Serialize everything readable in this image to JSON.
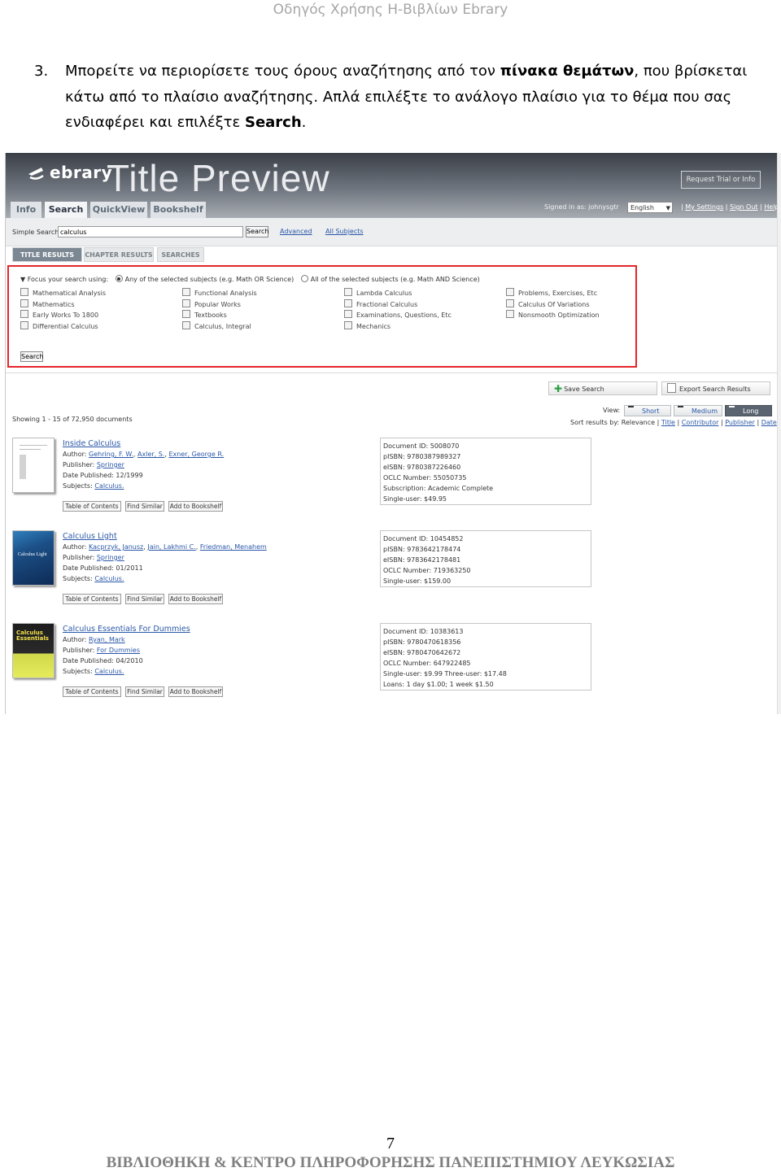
{
  "doc": {
    "header": "Οδηγός Χρήσης Η-Βιβλίων Ebrary",
    "step_number": "3.",
    "step_text_1": "Μπορείτε να περιορίσετε τους όρους αναζήτησης από τον ",
    "step_bold_1": "πίνακα θεμάτων",
    "step_text_2": ", που βρίσκεται κάτω από το πλαίσιο αναζήτησης. Απλά επιλέξτε το ανάλογο πλαίσιο για το θέμα που σας ενδιαφέρει και επιλέξτε ",
    "step_bold_2": "Search",
    "step_text_3": ".",
    "page_number": "7",
    "footer": "ΒΙΒΛΙΟΘΗΚΗ & ΚΕΝΤΡΟ ΠΛΗΡΟΦΟΡΗΣΗΣ ΠΑΝΕΠΙΣΤΗΜΙΟΥ ΛΕΥΚΩΣΙΑΣ"
  },
  "app": {
    "logo": "ebrary",
    "title": "Title Preview",
    "request_button": "Request Trial or Info",
    "tabs": [
      "Info",
      "Search",
      "QuickView",
      "Bookshelf"
    ],
    "active_tab": "Search",
    "signed_in": "Signed in as: johnysgtr",
    "language": "English",
    "top_links": [
      "My Settings",
      "Sign Out",
      "Help"
    ],
    "simple_search_label": "Simple Search:",
    "search_value": "calculus",
    "search_button": "Search",
    "advanced_link": "Advanced",
    "all_subjects_link": "All Subjects",
    "result_tabs": [
      "TITLE RESULTS",
      "CHAPTER RESULTS",
      "SEARCHES"
    ],
    "focus_label": "Focus your search using:",
    "focus_any": "Any of the selected subjects (e.g. Math OR Science)",
    "focus_all": "All of the selected subjects (e.g. Math AND Science)",
    "subjects": [
      [
        "Mathematical Analysis",
        "Mathematics",
        "Early Works To 1800",
        "Differential Calculus"
      ],
      [
        "Functional Analysis",
        "Popular Works",
        "Textbooks",
        "Calculus, Integral"
      ],
      [
        "Lambda Calculus",
        "Fractional Calculus",
        "Examinations, Questions, Etc",
        "Mechanics"
      ],
      [
        "Problems, Exercises, Etc",
        "Calculus Of Variations",
        "Nonsmooth Optimization"
      ]
    ],
    "panel_search_button": "Search",
    "save_search": "Save Search",
    "export_results": "Export Search Results",
    "view_label": "View:",
    "view_options": [
      "Short",
      "Medium",
      "Long"
    ],
    "active_view": "Long",
    "sort_label": "Sort results by: Relevance",
    "sort_links": [
      "Title",
      "Contributor",
      "Publisher",
      "Date"
    ],
    "showing": "Showing 1 - 15 of 72,950 documents",
    "result_buttons": [
      "Table of Contents",
      "Find Similar",
      "Add to Bookshelf"
    ],
    "results": [
      {
        "title": "Inside Calculus",
        "author_label": "Author:",
        "authors": [
          "Gehring, F. W.",
          "Axler, S.",
          "Exner, George R."
        ],
        "publisher_label": "Publisher:",
        "publisher": "Springer",
        "date": "Date Published: 12/1999",
        "subjects_label": "Subjects:",
        "subjects": "Calculus.",
        "details": [
          "Document ID: 5008070",
          "pISBN: 9780387989327",
          "eISBN: 9780387226460",
          "OCLC Number: 55050735",
          "Subscription: Academic Complete",
          "Single-user: $49.95"
        ]
      },
      {
        "title": "Calculus Light",
        "author_label": "Author:",
        "authors": [
          "Kacprzyk, Janusz",
          "Jain, Lakhmi C.",
          "Friedman, Menahem"
        ],
        "publisher_label": "Publisher:",
        "publisher": "Springer",
        "date": "Date Published: 01/2011",
        "subjects_label": "Subjects:",
        "subjects": "Calculus.",
        "cover_text": "Calculus Light",
        "details": [
          "Document ID: 10454852",
          "pISBN: 9783642178474",
          "eISBN: 9783642178481",
          "OCLC Number: 719363250",
          "Single-user: $159.00"
        ]
      },
      {
        "title": "Calculus Essentials For Dummies",
        "author_label": "Author:",
        "authors": [
          "Ryan, Mark"
        ],
        "publisher_label": "Publisher:",
        "publisher": "For Dummies",
        "date": "Date Published: 04/2010",
        "subjects_label": "Subjects:",
        "subjects": "Calculus.",
        "cover_text": "Calculus Essentials",
        "details": [
          "Document ID: 10383613",
          "pISBN: 9780470618356",
          "eISBN: 9780470642672",
          "OCLC Number: 647922485",
          "Single-user: $9.99 Three-user: $17.48",
          "Loans: 1 day $1.00; 1 week $1.50"
        ]
      }
    ]
  },
  "colors": {
    "highlight": "#e3262b",
    "link": "#2a57a8",
    "header_gray": "#a6a6a6"
  }
}
